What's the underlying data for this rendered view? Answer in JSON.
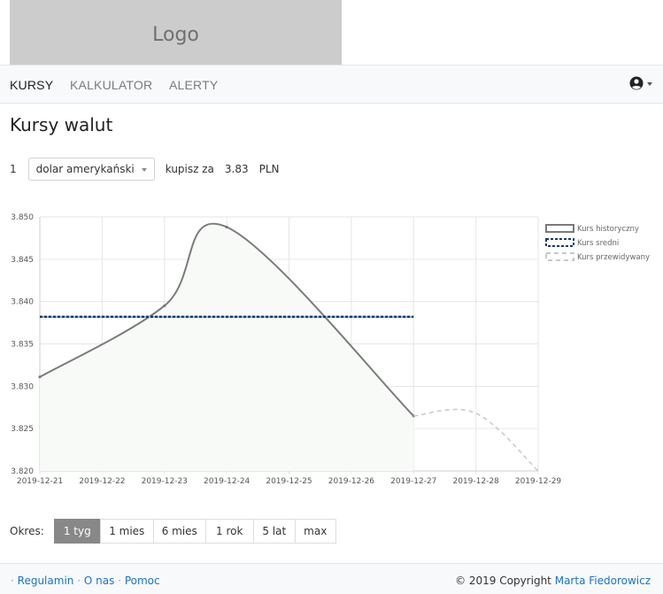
{
  "header": {
    "logo_text": "Logo"
  },
  "nav": {
    "items": [
      {
        "label": "KURSY",
        "active": true
      },
      {
        "label": "KALKULATOR",
        "active": false
      },
      {
        "label": "ALERTY",
        "active": false
      }
    ],
    "user_icon": "user-circle-icon"
  },
  "page": {
    "title": "Kursy walut"
  },
  "converter": {
    "amount": "1",
    "currency": "dolar amerykański",
    "buy_label": "kupisz za",
    "rate": "3.83",
    "target_currency": "PLN"
  },
  "chart_data": {
    "type": "line",
    "x": [
      "2019-12-21",
      "2019-12-22",
      "2019-12-23",
      "2019-12-24",
      "2019-12-25",
      "2019-12-26",
      "2019-12-27",
      "2019-12-28",
      "2019-12-29"
    ],
    "ylim": [
      3.82,
      3.85
    ],
    "yticks": [
      "3.850",
      "3.845",
      "3.840",
      "3.835",
      "3.830",
      "3.825",
      "3.820"
    ],
    "grid": true,
    "legend_position": "right",
    "series": [
      {
        "name": "Kurs historyczny",
        "color": "#7a7a7a",
        "style": "solid",
        "fill": "#f8faf8",
        "points": [
          [
            "2019-12-21",
            3.8311
          ],
          [
            "2019-12-23",
            3.8395
          ],
          [
            "2019-12-24",
            3.8488
          ],
          [
            "2019-12-27",
            3.8265
          ]
        ]
      },
      {
        "name": "Kurs sredni",
        "color": "#1a3a66",
        "style": "dotted",
        "points": [
          [
            "2019-12-21",
            3.8382
          ],
          [
            "2019-12-27",
            3.8382
          ]
        ]
      },
      {
        "name": "Kurs przewidywany",
        "color": "#c8c8c8",
        "style": "dashed",
        "points": [
          [
            "2019-12-27",
            3.8265
          ],
          [
            "2019-12-28",
            3.8268
          ],
          [
            "2019-12-29",
            3.82
          ]
        ]
      }
    ]
  },
  "period": {
    "label": "Okres:",
    "options": [
      {
        "label": "1 tyg",
        "active": true
      },
      {
        "label": "1 mies",
        "active": false
      },
      {
        "label": "6 mies",
        "active": false
      },
      {
        "label": "1 rok",
        "active": false
      },
      {
        "label": "5 lat",
        "active": false
      },
      {
        "label": "max",
        "active": false
      }
    ]
  },
  "footer": {
    "links": [
      "Regulamin",
      "O nas",
      "Pomoc"
    ],
    "separator": "·",
    "copyright_text": "© 2019 Copyright",
    "author": "Marta Fiedorowicz"
  }
}
